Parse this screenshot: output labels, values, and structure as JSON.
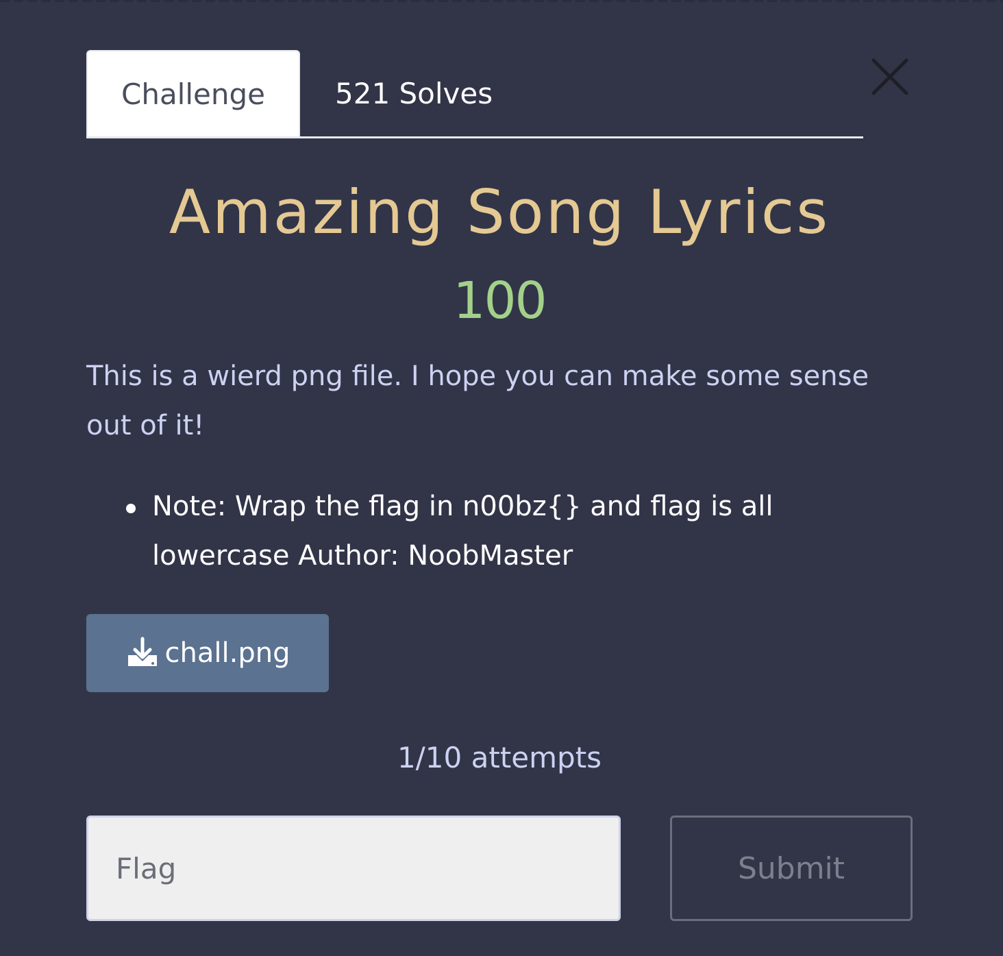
{
  "tabs": {
    "challenge": "Challenge",
    "solves": "521 Solves"
  },
  "challenge": {
    "name": "Amazing Song Lyrics",
    "value": "100",
    "description": "This is a wierd png file. I hope you can make some sense out of it!",
    "notes": [
      "Note: Wrap the flag in n00bz{} and flag is all lowercase Author: NoobMaster"
    ]
  },
  "file": {
    "name": "chall.png",
    "icon": "download-icon"
  },
  "attempts": "1/10 attempts",
  "form": {
    "flag_placeholder": "Flag",
    "flag_value": "",
    "submit_label": "Submit"
  },
  "icons": {
    "close": "close-icon"
  },
  "colors": {
    "background": "#323548",
    "title": "#e5c993",
    "value": "#a3d18a",
    "text": "#cdd2f2",
    "download_button": "#5b7290"
  }
}
